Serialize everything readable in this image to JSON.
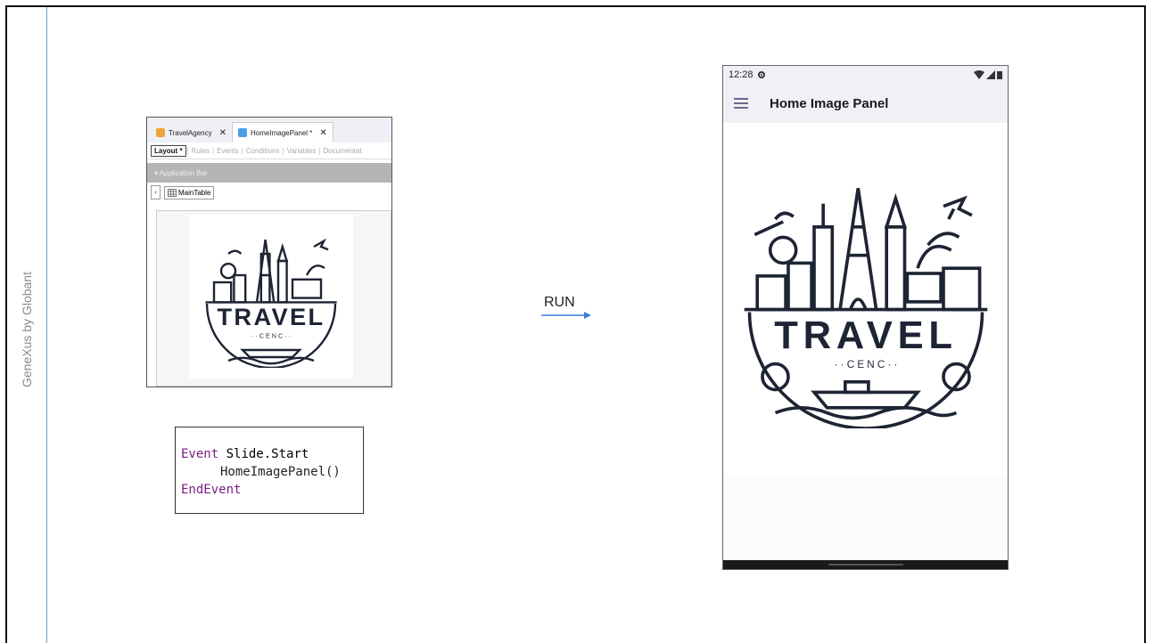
{
  "sidebar_label": "GeneXus by Globant",
  "ide": {
    "tabs": [
      {
        "label": "TravelAgency",
        "close": "✕"
      },
      {
        "label": "HomeImagePanel *",
        "close": "✕"
      }
    ],
    "subtabs": [
      "Layout *",
      "Rules",
      "Events",
      "Conditions",
      "Variables",
      "Documentat"
    ],
    "app_bar": "▾ Application Bar",
    "main_table": "MainTable",
    "collapse_glyph": "‹"
  },
  "logo": {
    "word": "TRAVEL",
    "sub": "· · C E N C · ·"
  },
  "code": {
    "line1_kw": "Event",
    "line1_rest": " Slide.Start",
    "line2": "HomeImagePanel()",
    "line3_kw": "EndEvent"
  },
  "run_label": "RUN",
  "phone": {
    "time": "12:28",
    "title": "Home Image Panel"
  },
  "colors": {
    "keyword": "#7a1d85",
    "arrow": "#3d7ee0",
    "app_bar_bg": "#f1f0f7"
  },
  "icons": [
    "gear-icon",
    "wifi-icon",
    "signal-icon",
    "battery-icon",
    "menu-icon",
    "close-icon",
    "table-icon",
    "arrow-right-icon"
  ]
}
